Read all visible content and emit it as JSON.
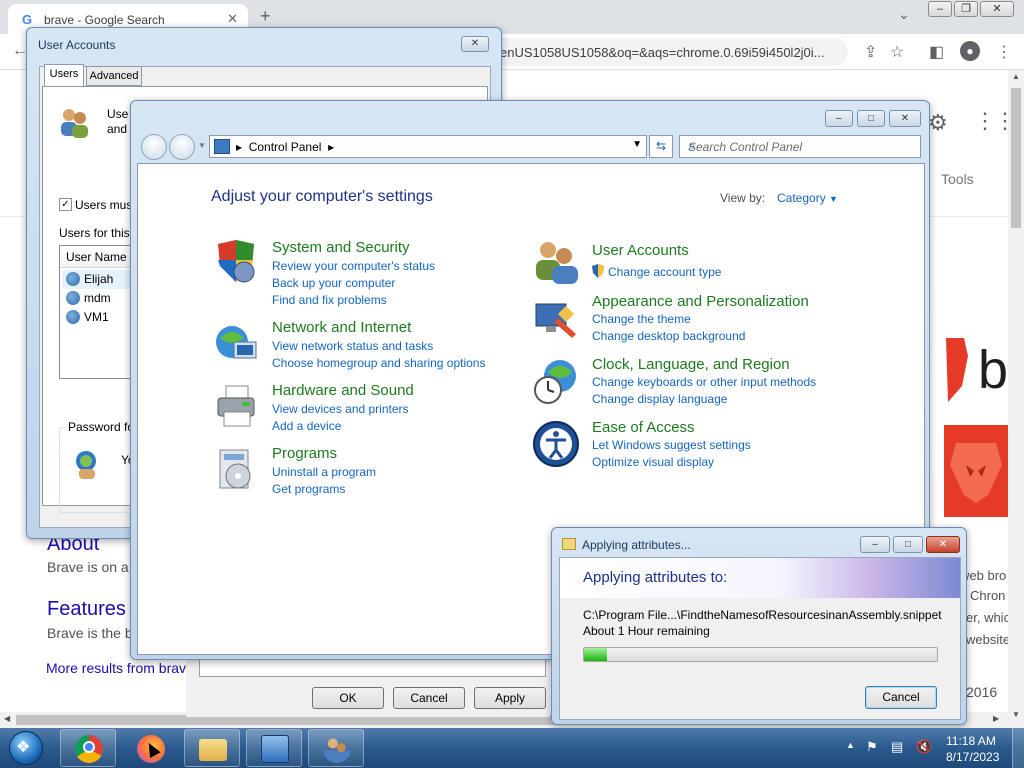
{
  "chrome": {
    "tab_title": "brave - Google Search",
    "tab_favicon": "G",
    "new_tab": "+",
    "url_fragment": "enUS1058US1058&oq=&aqs=chrome.0.69i59i450l2j0i...",
    "tools_label": "Tools",
    "serp": {
      "about_heading": "About",
      "about_snippet": "Brave is on a",
      "features_heading": "Features",
      "features_snippet": "Brave is the b",
      "more_results": "More results from brav",
      "right_snips": [
        "web bro",
        "Chron",
        "er, whic",
        "website"
      ],
      "year": "2016"
    }
  },
  "user_accounts": {
    "title": "User Accounts",
    "tabs": [
      "Users",
      "Advanced"
    ],
    "intro_line1": "Use th",
    "intro_line2": "and t",
    "users_must": "Users must",
    "users_for": "Users for this c",
    "column_header": "User Name",
    "users": [
      "Elijah",
      "mdm",
      "VM1"
    ],
    "password_label": "Password for",
    "password_text": "Yo",
    "buttons": {
      "ok": "OK",
      "cancel": "Cancel",
      "apply": "Apply"
    }
  },
  "control_panel": {
    "breadcrumb": "Control Panel",
    "search_placeholder": "Search Control Panel",
    "heading": "Adjust your computer's settings",
    "view_by_label": "View by:",
    "view_by_value": "Category",
    "categories_left": [
      {
        "title": "System and Security",
        "links": [
          "Review your computer's status",
          "Back up your computer",
          "Find and fix problems"
        ]
      },
      {
        "title": "Network and Internet",
        "links": [
          "View network status and tasks",
          "Choose homegroup and sharing options"
        ]
      },
      {
        "title": "Hardware and Sound",
        "links": [
          "View devices and printers",
          "Add a device"
        ]
      },
      {
        "title": "Programs",
        "links": [
          "Uninstall a program",
          "Get programs"
        ]
      }
    ],
    "categories_right": [
      {
        "title": "User Accounts",
        "links": [
          "Change account type"
        ]
      },
      {
        "title": "Appearance and Personalization",
        "links": [
          "Change the theme",
          "Change desktop background"
        ]
      },
      {
        "title": "Clock, Language, and Region",
        "links": [
          "Change keyboards or other input methods",
          "Change display language"
        ]
      },
      {
        "title": "Ease of Access",
        "links": [
          "Let Windows suggest settings",
          "Optimize visual display"
        ]
      }
    ]
  },
  "applying": {
    "title": "Applying attributes...",
    "heading": "Applying attributes to:",
    "path": "C:\\Program File...\\FindtheNamesofResourcesinanAssembly.snippet",
    "remaining": "About 1 Hour remaining",
    "progress_fraction": 0.065,
    "cancel": "Cancel"
  },
  "taskbar": {
    "time": "11:18 AM",
    "date": "8/17/2023",
    "pinned": [
      "chrome",
      "firefox",
      "file-explorer",
      "control-panel",
      "user-accounts"
    ]
  },
  "colors": {
    "link_blue": "#1565c0",
    "category_green": "#1e7a1e",
    "progress_green": "#19b50e",
    "taskbar_blue": "#2a5a8d",
    "brave_orange": "#e53a27"
  }
}
